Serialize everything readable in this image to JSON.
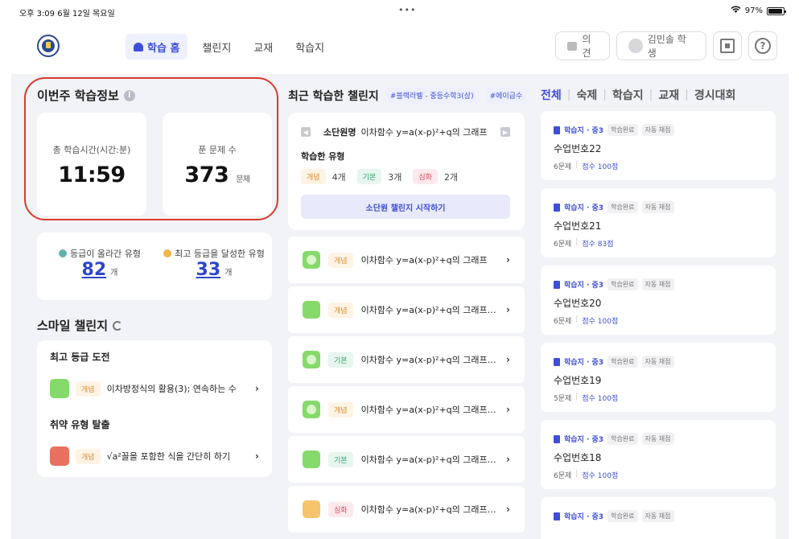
{
  "status_bar": {
    "time": "오후 3:09  6월 12일 목요일",
    "dots": "•••",
    "wifi": "wifi-icon",
    "battery": "97%",
    "battery_level": 0.97
  },
  "header": {
    "tabs": [
      {
        "label": "학습 홈",
        "active": true
      },
      {
        "label": "챌린지"
      },
      {
        "label": "교재"
      },
      {
        "label": "학습지"
      }
    ],
    "feedback_label": "의견",
    "user_label": "김민솔 학생",
    "qr_icon": "qr-scan-icon",
    "help_icon": "?"
  },
  "weekly": {
    "title": "이번주 학습정보",
    "info_icon": "i",
    "time_label": "총 학습시간(시간:분)",
    "time_value": "11:59",
    "solved_label": "푼 문제 수",
    "solved_value": "373",
    "solved_unit": "문제"
  },
  "grades": {
    "up_label": "등급이 올라간 유형",
    "up_value": "82",
    "up_unit": "개",
    "top_label": "최고 등급을 달성한 유형",
    "top_value": "33",
    "top_unit": "개"
  },
  "smile": {
    "title": "스마일 챌린지",
    "group1_title": "최고 등급 도전",
    "group1_item": {
      "tag": "개념",
      "text": "이차방정식의 활용(3); 연속하는 수",
      "color": "#86d96b"
    },
    "group2_title": "취약 유형 탈출",
    "group2_item": {
      "tag": "개념",
      "text": "√a²꼴을 포함한 식을 간단히 하기",
      "color": "#e8705e"
    }
  },
  "recent": {
    "title": "최근 학습한 챌린지",
    "pill1": "#블랙라벨 - 중등수학3(상)",
    "pill2": "#에이급수",
    "prev": "◀",
    "next": "▶",
    "unit_bold": "소단원명",
    "unit_name": "이차함수 y=a(x-p)²+q의 그래프",
    "learned_types": "학습한 유형",
    "concept_tag": "개념",
    "concept_count": "4개",
    "basic_tag": "기본",
    "basic_count": "3개",
    "deep_tag": "심화",
    "deep_count": "2개",
    "start_label": "소단원 챌린지 시작하기",
    "items": [
      {
        "tag": "개념",
        "text": "이차함수 y=a(x-p)²+q의 그래프",
        "color": "#86d96b"
      },
      {
        "tag": "개념",
        "text": "이차함수 y=a(x-p)²+q의 그래프의...",
        "color": "#86d96b"
      },
      {
        "tag": "기본",
        "text": "이차함수 y=a(x-p)²+q의 그래프의...",
        "color": "#86d96b"
      },
      {
        "tag": "개념",
        "text": "이차함수 y=a(x-p)²+q의 그래프가...",
        "color": "#86d96b"
      },
      {
        "tag": "기본",
        "text": "이차함수 y=a(x-p)²+q의 그래프가...",
        "color": "#86d96b"
      },
      {
        "tag": "심화",
        "text": "이차함수 y=a(x-p)²+q의 그래프가...",
        "color": "#f6c46a"
      }
    ]
  },
  "filters": [
    "전체",
    "숙제",
    "학습지",
    "교재",
    "경시대회"
  ],
  "homework": [
    {
      "subject": "학습지 · 중3",
      "tag1": "학습완료",
      "tag2": "자동 채점",
      "name": "수업번호22",
      "count": "6문제",
      "score": "점수 100점"
    },
    {
      "subject": "학습지 · 중3",
      "tag1": "학습완료",
      "tag2": "자동 채점",
      "name": "수업번호21",
      "count": "6문제",
      "score": "점수 83점"
    },
    {
      "subject": "학습지 · 중3",
      "tag1": "학습완료",
      "tag2": "자동 채점",
      "name": "수업번호20",
      "count": "6문제",
      "score": "점수 100점"
    },
    {
      "subject": "학습지 · 중3",
      "tag1": "학습완료",
      "tag2": "자동 채점",
      "name": "수업번호19",
      "count": "5문제",
      "score": "점수 100점"
    },
    {
      "subject": "학습지 · 중3",
      "tag1": "학습완료",
      "tag2": "자동 채점",
      "name": "수업번호18",
      "count": "6문제",
      "score": "점수 100점"
    },
    {
      "subject": "학습지 · 중3",
      "tag1": "학습완료",
      "tag2": "자동 채점",
      "name": "",
      "count": "",
      "score": ""
    }
  ]
}
